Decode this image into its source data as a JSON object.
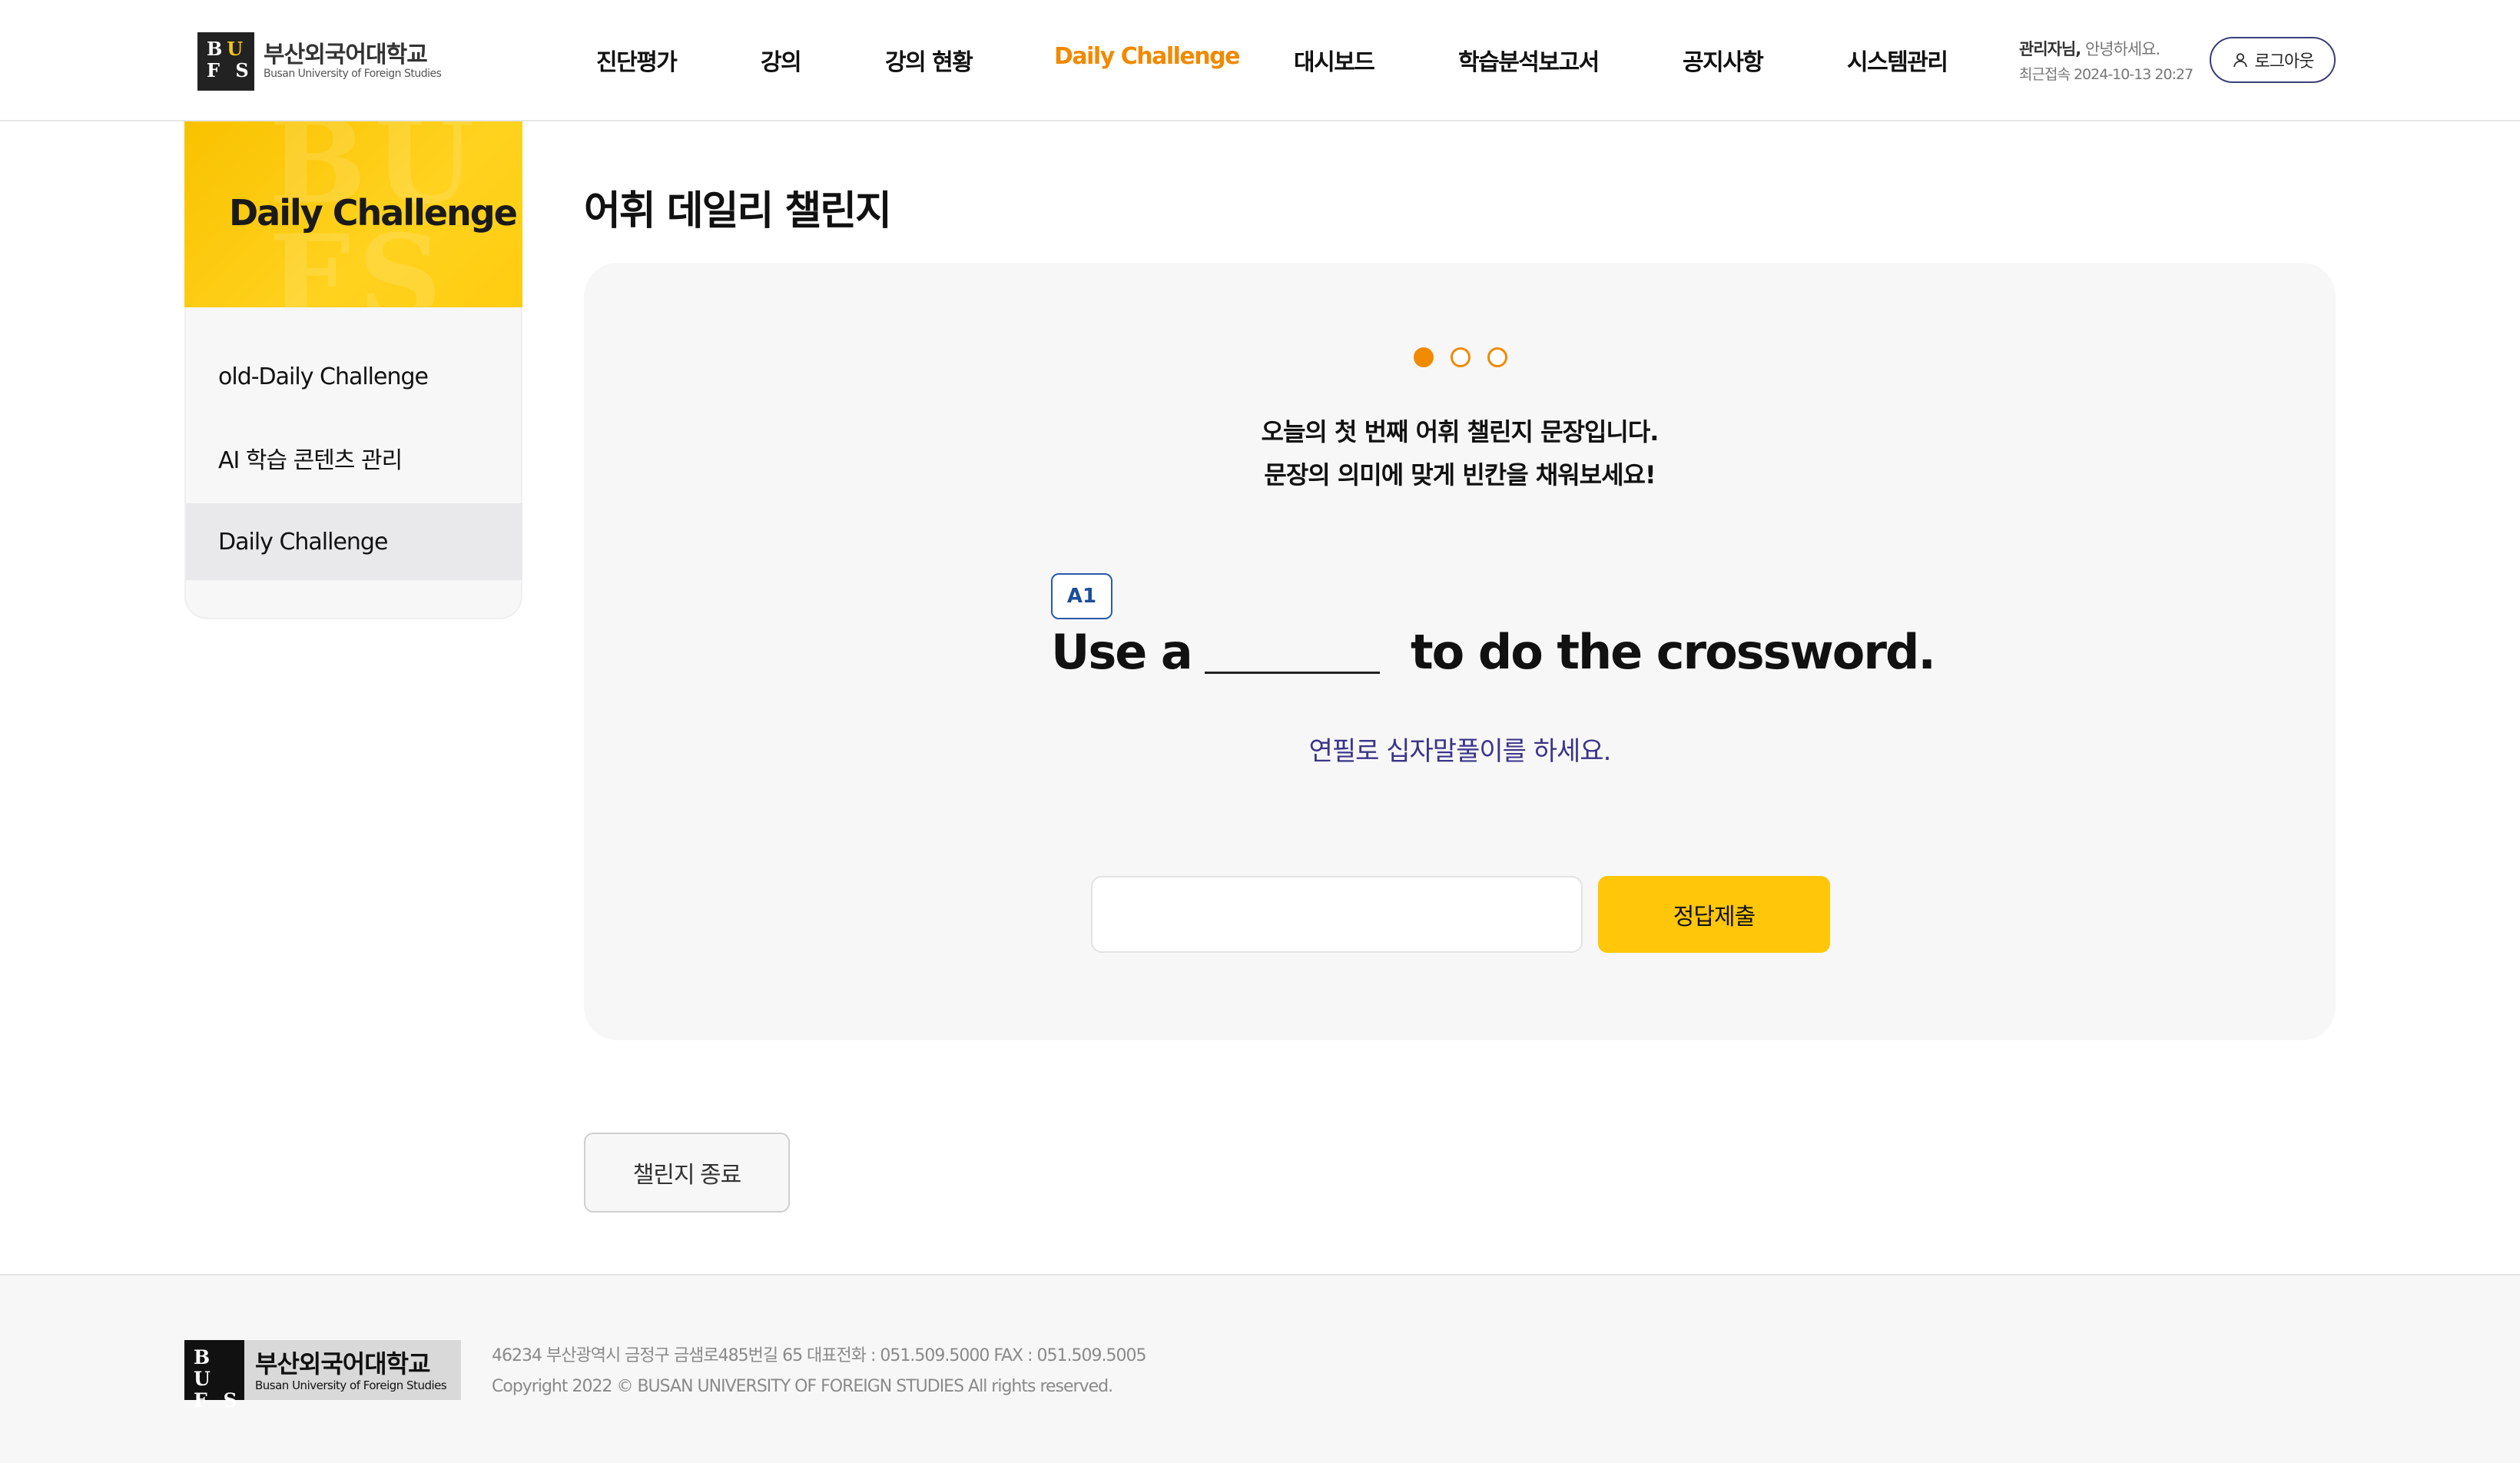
{
  "header": {
    "logo": {
      "ko": "부산외국어대학교",
      "en": "Busan University of Foreign Studies",
      "mark": [
        "B",
        "U",
        "F",
        "S"
      ]
    },
    "nav": [
      {
        "label": "진단평가",
        "active": false
      },
      {
        "label": "강의",
        "active": false
      },
      {
        "label": "강의 현황",
        "active": false
      },
      {
        "label": "Daily Challenge",
        "active": true
      },
      {
        "label": "대시보드",
        "active": false
      },
      {
        "label": "학습분석보고서",
        "active": false
      },
      {
        "label": "공지사항",
        "active": false
      },
      {
        "label": "시스템관리",
        "active": false
      }
    ],
    "user_name": "관리자님,",
    "greeting": "안녕하세요.",
    "last_login": "최근접속 2024-10-13 20:27",
    "logout_label": "로그아웃",
    "accent_color": "#f08a00"
  },
  "sidebar": {
    "hero_title": "Daily Challenge",
    "hero_bg_text": "BU\nFS",
    "items": [
      {
        "label": "old-Daily Challenge",
        "active": false
      },
      {
        "label": "AI 학습 콘텐츠 관리",
        "active": false
      },
      {
        "label": "Daily Challenge",
        "active": true
      }
    ]
  },
  "main": {
    "page_title": "어휘 데일리 챌린지",
    "progress": {
      "total": 3,
      "current": 1
    },
    "instruction_line1": "오늘의 첫 번째 어휘 챌린지 문장입니다.",
    "instruction_line2": "문장의 의미에 맞게 빈칸을 채워보세요!",
    "level": "A1",
    "sentence_before": "Use a",
    "sentence_after": "to do the crossword.",
    "translation": "연필로 십자말풀이를 하세요.",
    "answer_value": "",
    "submit_label": "정답제출",
    "end_label": "챌린지 종료",
    "submit_color": "#ffc60a"
  },
  "footer": {
    "logo": {
      "ko": "부산외국어대학교",
      "en": "Busan University of Foreign Studies"
    },
    "address": "46234 부산광역시 금정구 금샘로485번길 65 대표전화 : 051.509.5000 FAX : 051.509.5005",
    "copyright": "Copyright 2022 © BUSAN UNIVERSITY OF FOREIGN STUDIES All rights reserved."
  }
}
